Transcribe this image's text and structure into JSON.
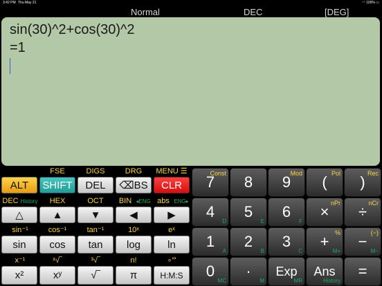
{
  "status_bar": {
    "time": "3:42 PM",
    "date": "Thu May 21",
    "wifi_icon": "wifi-icon",
    "battery": "100%"
  },
  "mode_bar": {
    "mode": "Normal",
    "base": "DEC",
    "angle": "[DEG]"
  },
  "display": {
    "expression": "sin(30)^2+cos(30)^2",
    "result": "=1"
  },
  "left_keypad": {
    "row1_labels": [
      {
        "text": "FSE",
        "color": "#ffd447"
      },
      {
        "text": "DIGS",
        "color": "#ffd447"
      },
      {
        "text": "DRG",
        "color": "#ffd447"
      },
      {
        "text": "MENU ☰",
        "color": "#ffd447"
      }
    ],
    "row1_keys": [
      "ALT",
      "SHIFT",
      "DEL",
      "⌫BS",
      "CLR"
    ],
    "row2_labels": [
      {
        "text": "DEC",
        "color": "#ffd447"
      },
      {
        "text": "History",
        "color": "#1faa6a"
      },
      {
        "text": "HEX",
        "color": "#ffd447"
      },
      {
        "text": "OCT",
        "color": "#ffd447"
      },
      {
        "text": "BIN",
        "color": "#ffd447"
      },
      {
        "text": "◂ENG",
        "color": "#1faa6a"
      },
      {
        "text": "abs",
        "color": "#ffd447"
      },
      {
        "text": "ENG▸",
        "color": "#1faa6a"
      }
    ],
    "row2_keys": [
      "△",
      "▲",
      "▼",
      "◀",
      "▶"
    ],
    "row3_labels": [
      "sin⁻¹",
      "cos⁻¹",
      "tan⁻¹",
      "10ˣ",
      "eˣ"
    ],
    "row3_keys": [
      "sin",
      "cos",
      "tan",
      "log",
      "ln"
    ],
    "row4_labels": [
      "x⁻¹",
      "ˣ√‾",
      "³√‾",
      "n!",
      "∘′″"
    ],
    "row4_keys": [
      "x²",
      "xʸ",
      "√‾",
      "π",
      "H:M:S"
    ]
  },
  "right_keypad": {
    "rows": [
      [
        {
          "main": "7",
          "tr": "Const",
          "br": ""
        },
        {
          "main": "8",
          "tr": "",
          "br": ""
        },
        {
          "main": "9",
          "tr": "Mod",
          "br": ""
        },
        {
          "main": "(",
          "tr": "Pol",
          "br": ""
        },
        {
          "main": ")",
          "tr": "Rec",
          "br": ""
        }
      ],
      [
        {
          "main": "4",
          "tr": "",
          "br": "D"
        },
        {
          "main": "5",
          "tr": "",
          "br": "E"
        },
        {
          "main": "6",
          "tr": "",
          "br": "F"
        },
        {
          "main": "×",
          "tr": "nPr",
          "br": ""
        },
        {
          "main": "÷",
          "tr": "nCr",
          "br": ""
        }
      ],
      [
        {
          "main": "1",
          "tr": "",
          "br": "A"
        },
        {
          "main": "2",
          "tr": "",
          "br": "B"
        },
        {
          "main": "3",
          "tr": "",
          "br": "C"
        },
        {
          "main": "+",
          "tr": "%",
          "br": "M+"
        },
        {
          "main": "−",
          "tr": "(−)",
          "br": "M−"
        }
      ],
      [
        {
          "main": "0",
          "tr": "",
          "br": "MC"
        },
        {
          "main": "·",
          "tr": "",
          "br": "M"
        },
        {
          "main": "Exp",
          "tr": "",
          "br": "MR"
        },
        {
          "main": "Ans",
          "tr": "",
          "br": "History"
        },
        {
          "main": "=",
          "tr": "",
          "br": ""
        }
      ]
    ]
  }
}
